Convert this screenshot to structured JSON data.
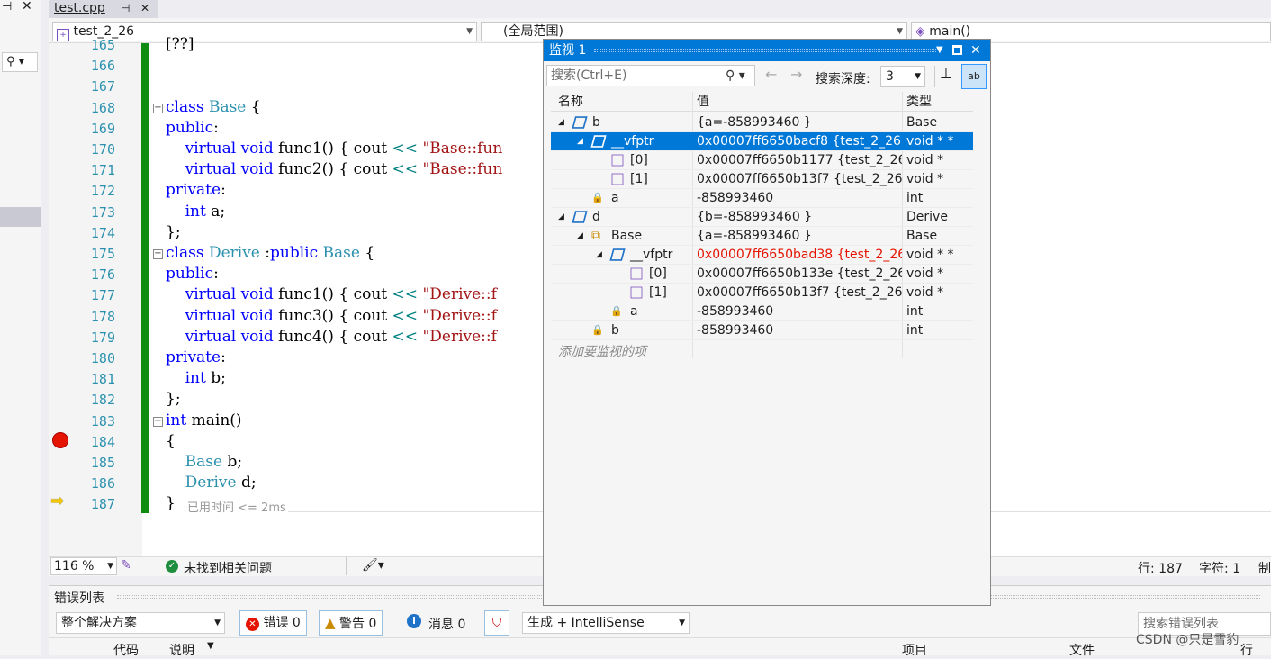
{
  "tab": {
    "title": "test.cpp",
    "pin": "⊣",
    "close": "✕"
  },
  "nav": {
    "project": "test_2_26",
    "scope": "(全局范围)",
    "function": "main()"
  },
  "code_lines": [
    {
      "num": "165",
      "text": "[??]"
    },
    {
      "num": "166",
      "text": ""
    },
    {
      "num": "167",
      "text": ""
    },
    {
      "num": "168",
      "text": "class Base {"
    },
    {
      "num": "169",
      "text": "public:"
    },
    {
      "num": "170",
      "text": "    virtual void func1() { cout << \"Base::fun"
    },
    {
      "num": "171",
      "text": "    virtual void func2() { cout << \"Base::fun"
    },
    {
      "num": "172",
      "text": "private:"
    },
    {
      "num": "173",
      "text": "    int a;"
    },
    {
      "num": "174",
      "text": "};"
    },
    {
      "num": "175",
      "text": "class Derive :public Base {"
    },
    {
      "num": "176",
      "text": "public:"
    },
    {
      "num": "177",
      "text": "    virtual void func1() { cout << \"Derive::f"
    },
    {
      "num": "178",
      "text": "    virtual void func3() { cout << \"Derive::f"
    },
    {
      "num": "179",
      "text": "    virtual void func4() { cout << \"Derive::f"
    },
    {
      "num": "180",
      "text": "private:"
    },
    {
      "num": "181",
      "text": "    int b;"
    },
    {
      "num": "182",
      "text": "};"
    },
    {
      "num": "183",
      "text": "int main()"
    },
    {
      "num": "184",
      "text": "{"
    },
    {
      "num": "185",
      "text": "    Base b;"
    },
    {
      "num": "186",
      "text": "    Derive d;"
    },
    {
      "num": "187",
      "text": "}"
    }
  ],
  "perf_tip": "已用时间 <= 2ms",
  "status": {
    "zoom": "116 %",
    "issues": "未找到相关问题",
    "line": "行: 187",
    "char": "字符: 1",
    "tail": "制"
  },
  "watch": {
    "title": "监视 1",
    "search_placeholder": "搜索(Ctrl+E)",
    "depth_label": "搜索深度:",
    "depth_value": "3",
    "headers": {
      "name": "名称",
      "value": "值",
      "type": "类型"
    },
    "rows": [
      {
        "name": "b",
        "value": "{a=-858993460 }",
        "type": "Base"
      },
      {
        "name": "__vfptr",
        "value": "0x00007ff6650bacf8 {test_2_26.e...",
        "type": "void * *"
      },
      {
        "name": "[0]",
        "value": "0x00007ff6650b1177 {test_2_26.e...",
        "type": "void *"
      },
      {
        "name": "[1]",
        "value": "0x00007ff6650b13f7 {test_2_26.e...",
        "type": "void *"
      },
      {
        "name": "a",
        "value": "-858993460",
        "type": "int"
      },
      {
        "name": "d",
        "value": "{b=-858993460 }",
        "type": "Derive"
      },
      {
        "name": "Base",
        "value": "{a=-858993460 }",
        "type": "Base"
      },
      {
        "name": "__vfptr",
        "value": "0x00007ff6650bad38 {test_2_26.e...",
        "type": "void * *"
      },
      {
        "name": "[0]",
        "value": "0x00007ff6650b133e {test_2_26.e...",
        "type": "void *"
      },
      {
        "name": "[1]",
        "value": "0x00007ff6650b13f7 {test_2_26.e...",
        "type": "void *"
      },
      {
        "name": "a",
        "value": "-858993460",
        "type": "int"
      },
      {
        "name": "b",
        "value": "-858993460",
        "type": "int"
      }
    ],
    "add_item": "添加要监视的项"
  },
  "errors": {
    "title": "错误列表",
    "scope": "整个解决方案",
    "errors": "错误 0",
    "warnings": "警告 0",
    "messages": "消息 0",
    "build": "生成 + IntelliSense",
    "search": "搜索错误列表",
    "col_code": "代码",
    "col_desc": "说明",
    "col_project": "项目",
    "col_file": "文件",
    "col_line": "行"
  },
  "watermark": "CSDN @只是雪豹",
  "colors": {
    "accent": "#0078d7",
    "breakpoint": "#e51400",
    "changed": "#e51400",
    "modified_bar": "#108c10"
  }
}
